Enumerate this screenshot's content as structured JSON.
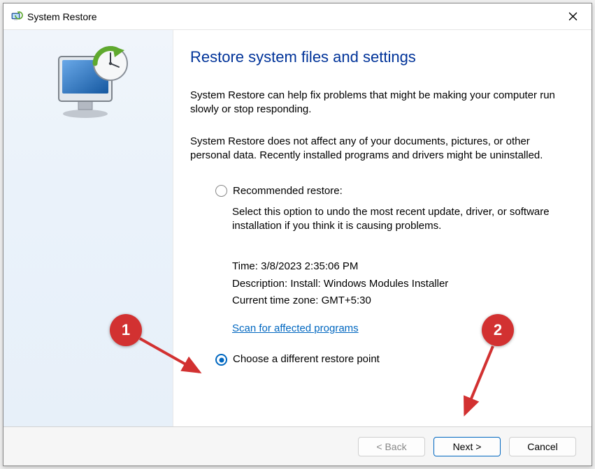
{
  "window": {
    "title": "System Restore"
  },
  "content": {
    "heading": "Restore system files and settings",
    "intro": "System Restore can help fix problems that might be making your computer run slowly or stop responding.",
    "sub": "System Restore does not affect any of your documents, pictures, or other personal data. Recently installed programs and drivers might be uninstalled.",
    "recommended": {
      "label": "Recommended restore:",
      "desc": "Select this option to undo the most recent update, driver, or software installation if you think it is causing problems."
    },
    "meta": {
      "time_label": "Time:",
      "time_value": "3/8/2023 2:35:06 PM",
      "desc_label": "Description:",
      "desc_value": "Install: Windows Modules Installer",
      "tz_label": "Current time zone:",
      "tz_value": "GMT+5:30",
      "scan_link": "Scan for affected programs"
    },
    "choose_label": "Choose a different restore point"
  },
  "footer": {
    "back": "< Back",
    "next": "Next >",
    "cancel": "Cancel"
  },
  "annotations": {
    "one": "1",
    "two": "2"
  }
}
